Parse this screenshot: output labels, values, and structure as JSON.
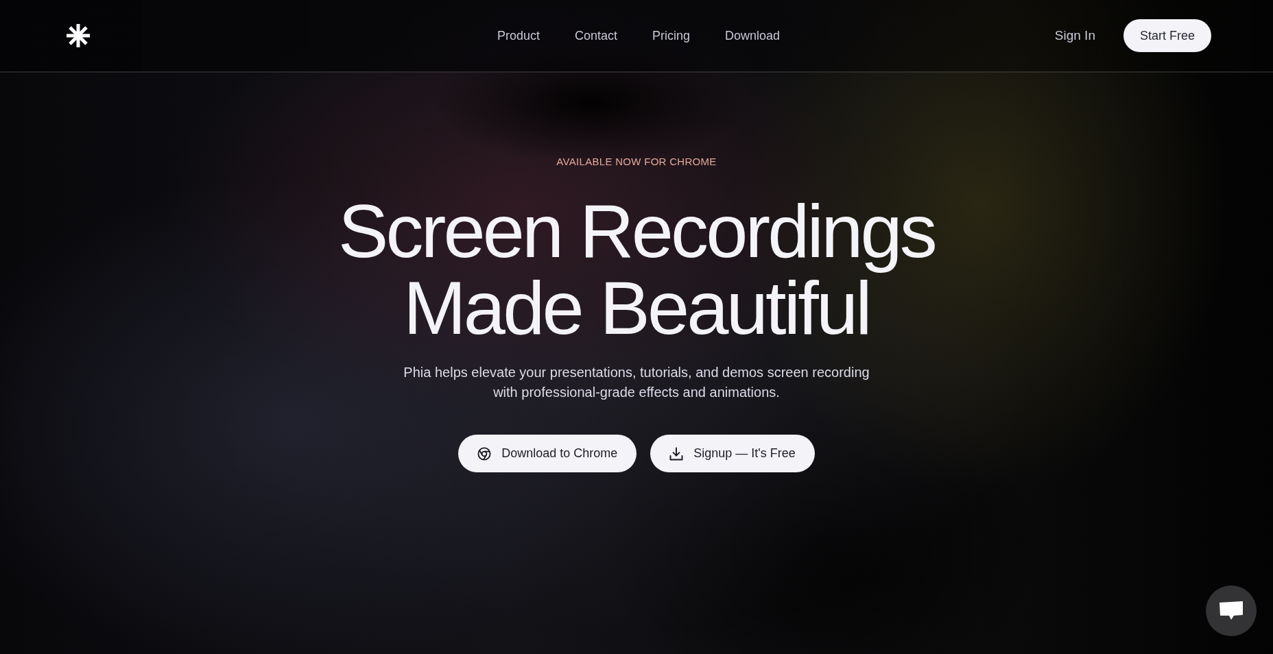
{
  "header": {
    "nav": [
      "Product",
      "Contact",
      "Pricing",
      "Download"
    ],
    "sign_in": "Sign In",
    "cta": "Start Free"
  },
  "hero": {
    "eyebrow": "AVAILABLE NOW FOR CHROME",
    "title": "Screen Recordings Made Beautiful",
    "description": "Phia helps elevate your presentations, tutorials, and demos screen recording with professional-grade effects and animations.",
    "buttons": [
      "Download to Chrome",
      "Signup — It's Free"
    ]
  }
}
